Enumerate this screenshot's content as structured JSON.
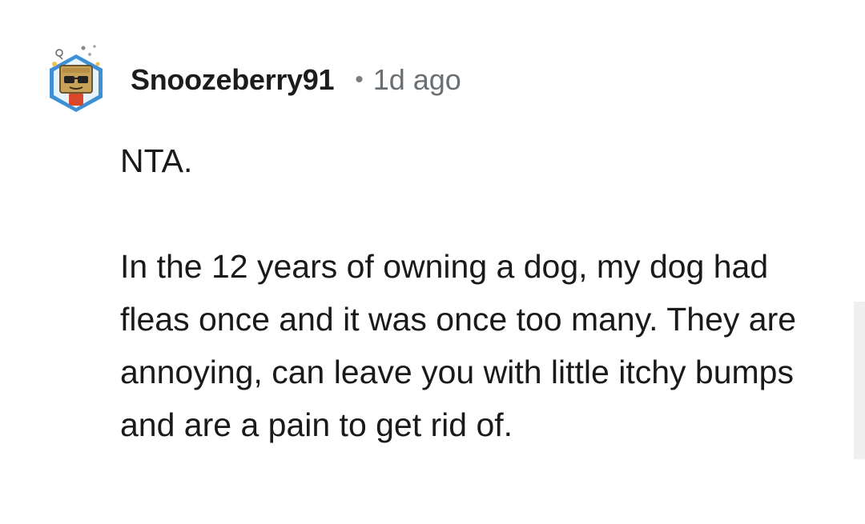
{
  "comment": {
    "username": "Snoozeberry91",
    "separator": "•",
    "timestamp": "1d ago",
    "avatar_icon": "snoovatar-robot-icon",
    "paragraphs": [
      "NTA.",
      "In the 12 years of owning a dog, my dog had fleas once and it was once too many. They are annoying, can leave you with little itchy bumps and are a pain to get rid of."
    ]
  },
  "colors": {
    "username": "#1c1c1c",
    "timestamp": "#6a6f73",
    "body_text": "#1a1a1b",
    "avatar_ring": "#3d8fd6",
    "background": "#ffffff"
  }
}
